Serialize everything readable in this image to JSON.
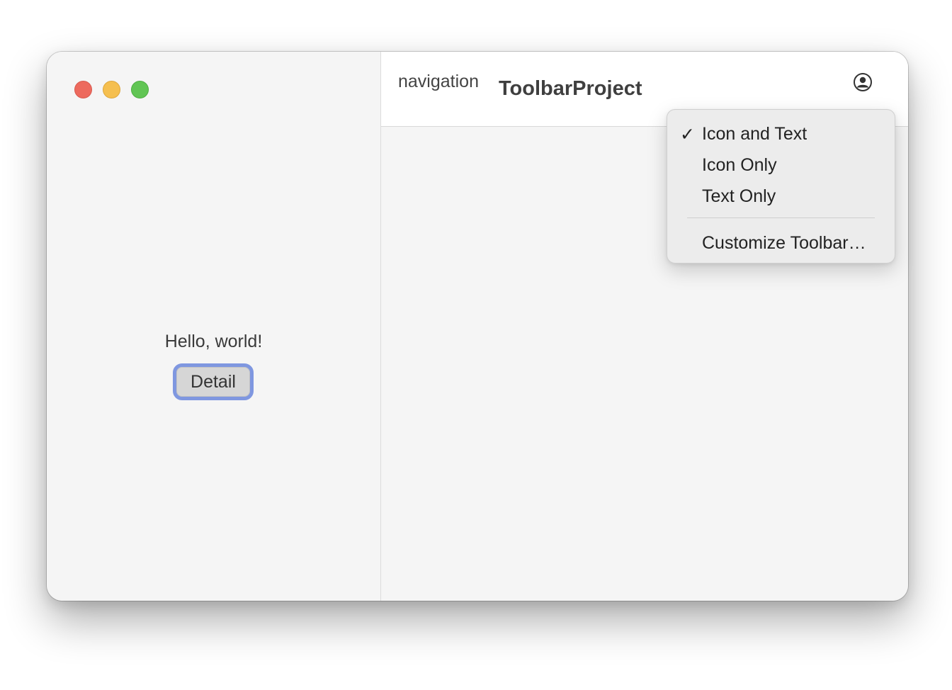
{
  "sidebar": {
    "greeting": "Hello, world!",
    "detail_button_label": "Detail"
  },
  "toolbar": {
    "navigation_label": "navigation",
    "title": "ToolbarProject",
    "account_icon": "person-circle-icon"
  },
  "context_menu": {
    "items": [
      {
        "label": "Icon and Text",
        "checked": true
      },
      {
        "label": "Icon Only",
        "checked": false
      },
      {
        "label": "Text Only",
        "checked": false
      },
      {
        "label": "Customize Toolbar…",
        "checked": false
      }
    ],
    "check_mark": "✓"
  },
  "colors": {
    "close": "#ed6a5e",
    "minimize": "#f5bf4f",
    "maximize": "#61c554",
    "focus_ring": "#7f97e0"
  }
}
